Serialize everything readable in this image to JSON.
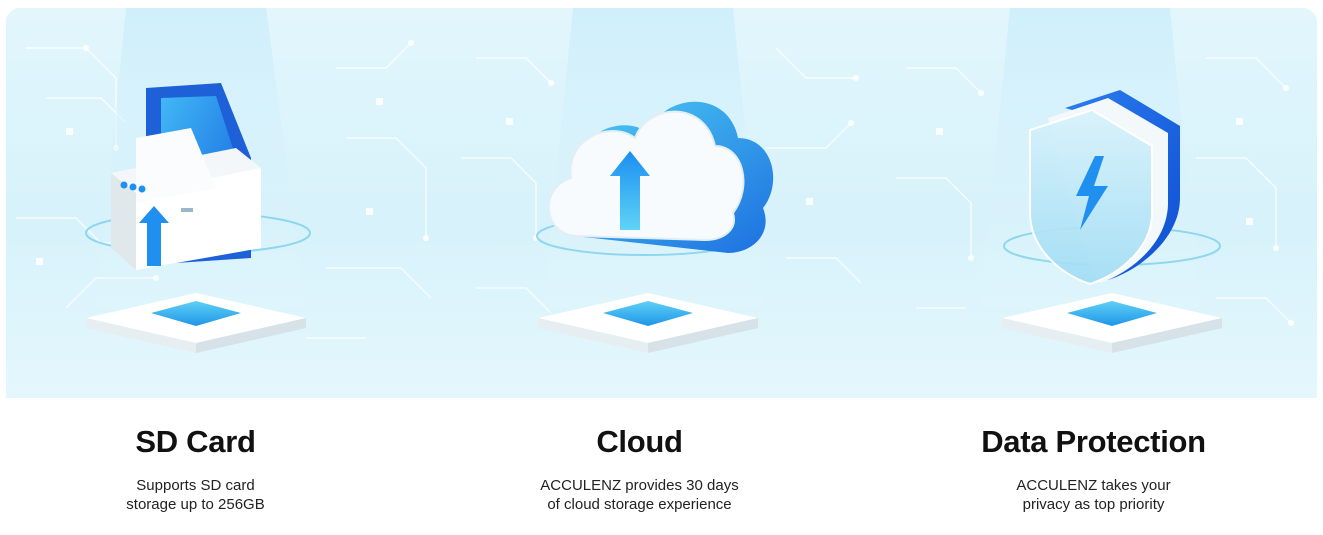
{
  "features": [
    {
      "title": "SD Card",
      "desc_line1": "Supports SD card",
      "desc_line2": "storage up to 256GB",
      "icon": "sd-card-icon"
    },
    {
      "title": "Cloud",
      "desc_line1": "ACCULENZ provides 30 days",
      "desc_line2": "of cloud storage experience",
      "icon": "cloud-upload-icon"
    },
    {
      "title": "Data Protection",
      "desc_line1": "ACCULENZ takes your",
      "desc_line2": "privacy as top priority",
      "icon": "shield-lightning-icon"
    }
  ],
  "colors": {
    "background": "#dcf3fb",
    "accent_blue": "#1f8ff0",
    "light_blue": "#5cc7f2"
  }
}
